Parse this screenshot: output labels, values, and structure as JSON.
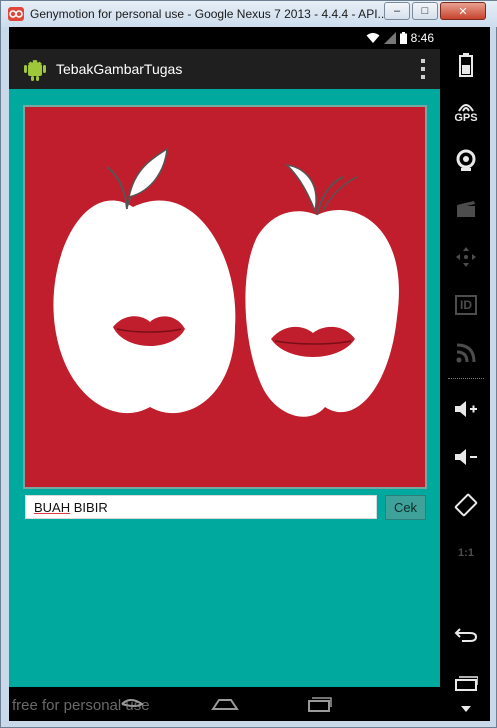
{
  "window": {
    "title": "Genymotion for personal use - Google Nexus 7 2013 - 4.4.4 - API...",
    "minimize_label": "–",
    "maximize_label": "□",
    "close_label": "✕"
  },
  "statusbar": {
    "time": "8:46"
  },
  "app": {
    "title": "TebakGambarTugas"
  },
  "quiz": {
    "answer_word1": "BUAH",
    "answer_word2": "BIBIR",
    "check_label": "Cek"
  },
  "watermark": {
    "text": "free for personal use"
  },
  "sidebar": {
    "gps_label": "GPS",
    "id_label": "ID",
    "ratio_label": "1:1"
  },
  "colors": {
    "content_bg": "#00a99d",
    "image_bg": "#c11e2d",
    "button_bg": "#3fa29a",
    "toolbar_bg": "#1f1f1f"
  }
}
